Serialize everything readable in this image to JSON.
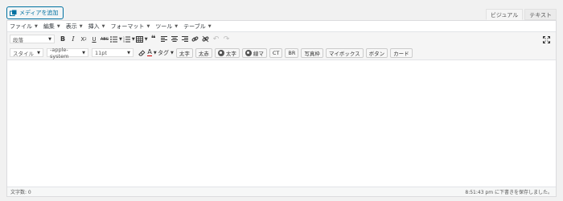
{
  "media_button": {
    "label": "メディアを追加",
    "icon": "add-media-icon"
  },
  "tabs": [
    {
      "label": "ビジュアル",
      "active": true
    },
    {
      "label": "テキスト",
      "active": false
    }
  ],
  "menubar": {
    "items": [
      {
        "label": "ファイル"
      },
      {
        "label": "編集"
      },
      {
        "label": "表示"
      },
      {
        "label": "挿入"
      },
      {
        "label": "フォーマット"
      },
      {
        "label": "ツール"
      },
      {
        "label": "テーブル"
      }
    ]
  },
  "toolbar1": {
    "format_select": "段落",
    "buttons": [
      "bold-icon",
      "italic-icon",
      "superscript-icon",
      "underline-icon",
      "strikethrough-icon",
      "bullet-list-icon",
      "numbered-list-icon",
      "table-icon",
      "blockquote-icon",
      "align-left-icon",
      "align-center-icon",
      "align-right-icon",
      "insert-link-icon",
      "unlink-icon",
      "undo-icon",
      "redo-icon",
      "fullscreen-icon"
    ]
  },
  "toolbar2": {
    "style_select": "スタイル",
    "font_select": "-apple-system",
    "size_select": "11pt",
    "tag_label": "タグ",
    "buttons": [
      {
        "label": "太字"
      },
      {
        "label": "太赤"
      },
      {
        "label": "太字",
        "icon": "camera-icon"
      },
      {
        "label": "線マ",
        "icon": "camera-icon"
      },
      {
        "label": "CT"
      },
      {
        "label": "BR"
      },
      {
        "label": "写真枠"
      },
      {
        "label": "マイボックス"
      },
      {
        "label": "ボタン"
      },
      {
        "label": "カード"
      }
    ]
  },
  "statusbar": {
    "word_count": "文字数: 0",
    "saved_message": "8:51:43 pm に下書きを保存しました。"
  },
  "colors": {
    "accent": "#0071a1",
    "toolbar_bg": "#f5f5f5"
  }
}
